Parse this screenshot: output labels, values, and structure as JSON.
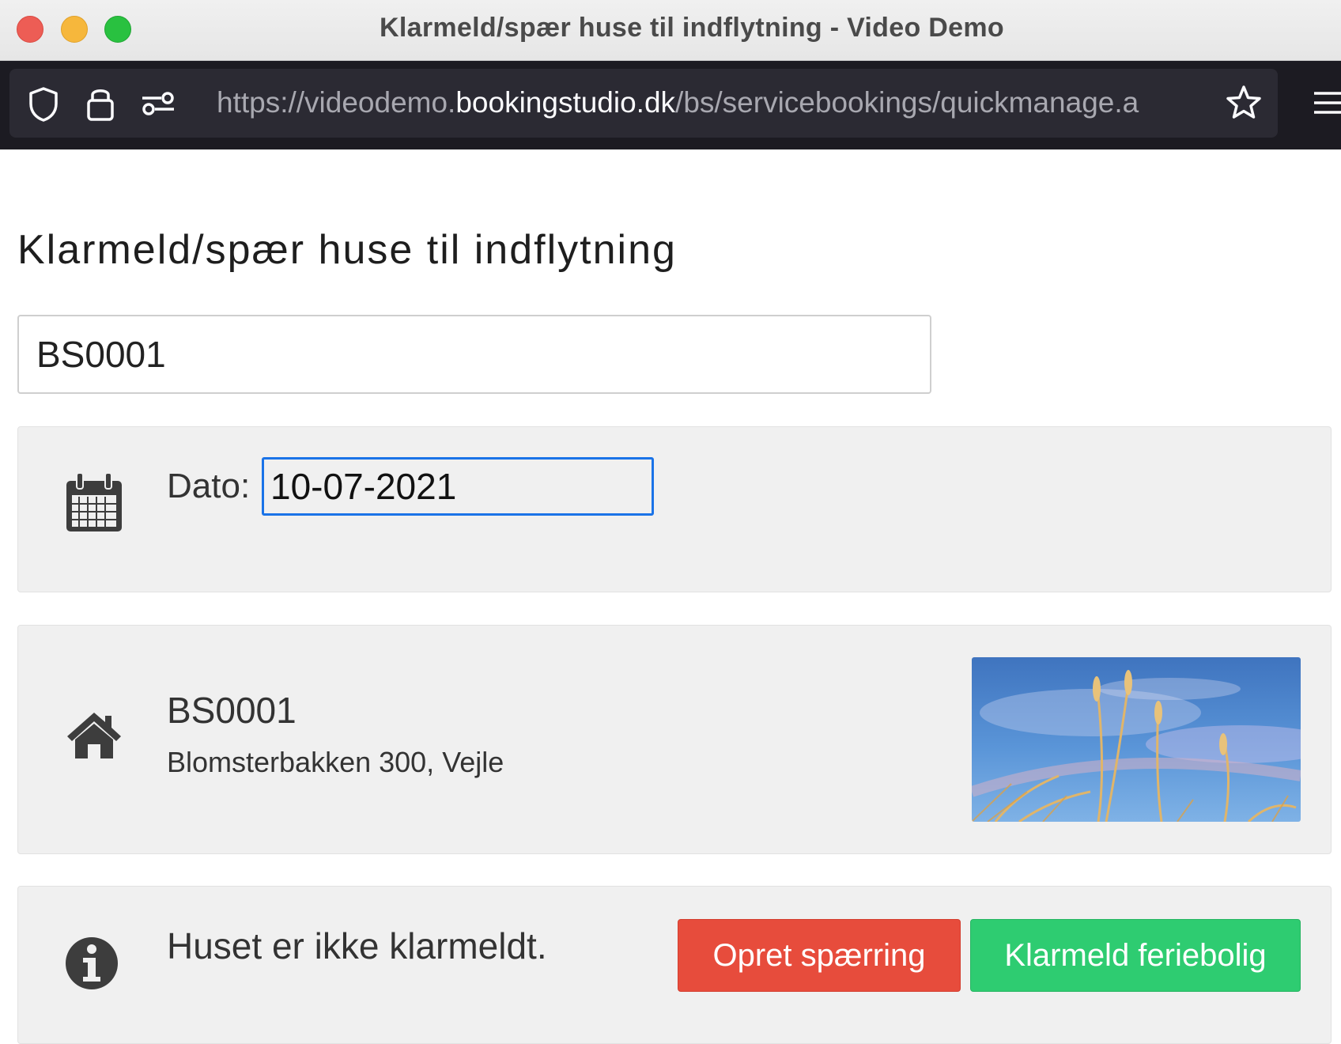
{
  "window": {
    "title": "Klarmeld/spær huse til indflytning - Video Demo"
  },
  "browser": {
    "url_prefix": "https://videodemo.",
    "url_host": "bookingstudio.dk",
    "url_path": "/bs/servicebookings/quickmanage.a",
    "icons": [
      "shield-icon",
      "lock-icon",
      "permissions-icon",
      "star-icon",
      "menu-icon"
    ]
  },
  "page": {
    "title": "Klarmeld/spær huse til indflytning",
    "search": {
      "value": "BS0001"
    },
    "date": {
      "label": "Dato:",
      "value": "10-07-2021",
      "icon": "calendar-icon"
    },
    "house": {
      "name": "BS0001",
      "address": "Blomsterbakken 300, Vejle",
      "icon": "home-icon",
      "image": "wheat-sky-photo"
    },
    "status": {
      "text": "Huset er ikke klarmeldt.",
      "icon": "info-icon",
      "block_button": "Opret spærring",
      "ready_button": "Klarmeld feriebolig"
    }
  },
  "colors": {
    "block_button": "#e74c3c",
    "ready_button": "#2ecc71",
    "focus_border": "#1a73e8",
    "panel_bg": "#f0f0f0"
  }
}
